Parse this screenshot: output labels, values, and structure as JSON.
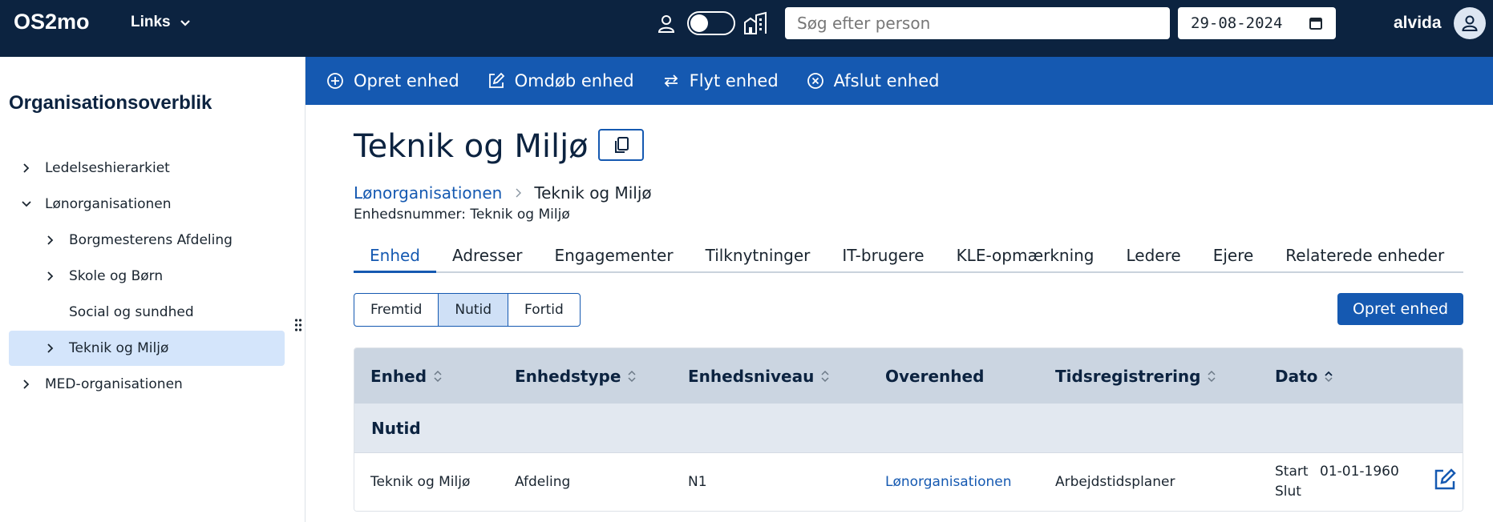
{
  "topbar": {
    "brand": "OS2mo",
    "links_label": "Links",
    "search_placeholder": "Søg efter person",
    "date": "29-08-2024",
    "username": "alvida"
  },
  "sidebar": {
    "title": "Organisationsoverblik",
    "items": [
      {
        "label": "Ledelseshierarkiet",
        "expanded": false
      },
      {
        "label": "Lønorganisationen",
        "expanded": true
      },
      {
        "label": "Borgmesterens Afdeling",
        "expanded": false
      },
      {
        "label": "Skole og Børn",
        "expanded": false
      },
      {
        "label": "Social og sundhed",
        "expanded": false
      },
      {
        "label": "Teknik og Miljø",
        "expanded": false,
        "selected": true
      },
      {
        "label": "MED-organisationen",
        "expanded": false
      }
    ]
  },
  "actions": {
    "create": "Opret enhed",
    "rename": "Omdøb enhed",
    "move": "Flyt enhed",
    "terminate": "Afslut enhed"
  },
  "main": {
    "title": "Teknik og Miljø",
    "breadcrumb": {
      "parent": "Lønorganisationen",
      "current": "Teknik og Miljø"
    },
    "unit_number": "Enhedsnummer: Teknik og Miljø",
    "tabs": [
      "Enhed",
      "Adresser",
      "Engagementer",
      "Tilknytninger",
      "IT-brugere",
      "KLE-opmærkning",
      "Ledere",
      "Ejere",
      "Relaterede enheder"
    ],
    "active_tab": "Enhed",
    "time_filter": [
      "Fremtid",
      "Nutid",
      "Fortid"
    ],
    "active_time_filter": "Nutid",
    "create_button": "Opret enhed",
    "table": {
      "columns": [
        "Enhed",
        "Enhedstype",
        "Enhedsniveau",
        "Overenhed",
        "Tidsregistrering",
        "Dato"
      ],
      "group_label": "Nutid",
      "rows": [
        {
          "unit": "Teknik og Miljø",
          "type": "Afdeling",
          "level": "N1",
          "parent": "Lønorganisationen",
          "time_registration": "Arbejdstidsplaner",
          "start_label": "Start",
          "start_date": "01-01-1960",
          "end_label": "Slut",
          "end_date": ""
        }
      ]
    }
  },
  "colors": {
    "topbar_bg": "#0c2340",
    "accent": "#1559b1",
    "selected_bg": "#d4e5fb",
    "table_header_bg": "#cbd5e1"
  }
}
